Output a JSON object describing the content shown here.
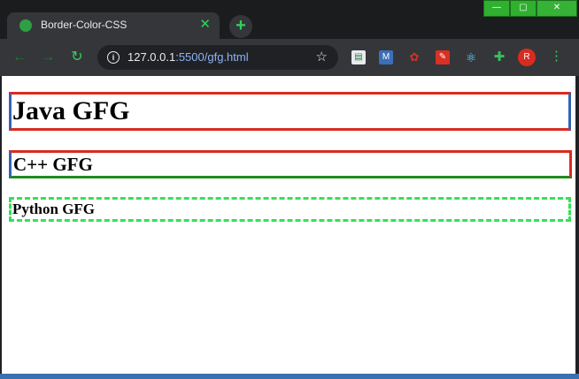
{
  "browser": {
    "tab": {
      "title": "Border-Color-CSS",
      "close_glyph": "✕"
    },
    "new_tab_glyph": "+",
    "window_controls": {
      "minimize": "—",
      "maximize": "▢",
      "close": "✕"
    },
    "toolbar": {
      "back_glyph": "←",
      "forward_glyph": "→",
      "reload_glyph": "↻",
      "url_host": "127.0.0.1",
      "url_port": ":5500",
      "url_path": "/gfg.html",
      "info_glyph": "i",
      "bookmark_glyph": "☆",
      "avatar_letter": "R",
      "menu_glyph": "⋮"
    },
    "extensions": [
      "extension-1-icon",
      "extension-2-icon",
      "extension-3-icon",
      "extension-4-icon",
      "react-devtools-icon",
      "puzzle-extensions-icon"
    ],
    "accent_color": "#2fd35a"
  },
  "page": {
    "heading1": "Java GFG",
    "heading2": "C++ GFG",
    "heading3": "Python GFG",
    "colors": {
      "red": "#d92b1f",
      "blue": "#3661b5",
      "green": "#1f8a1f",
      "dashed_green": "#34e05a"
    }
  }
}
